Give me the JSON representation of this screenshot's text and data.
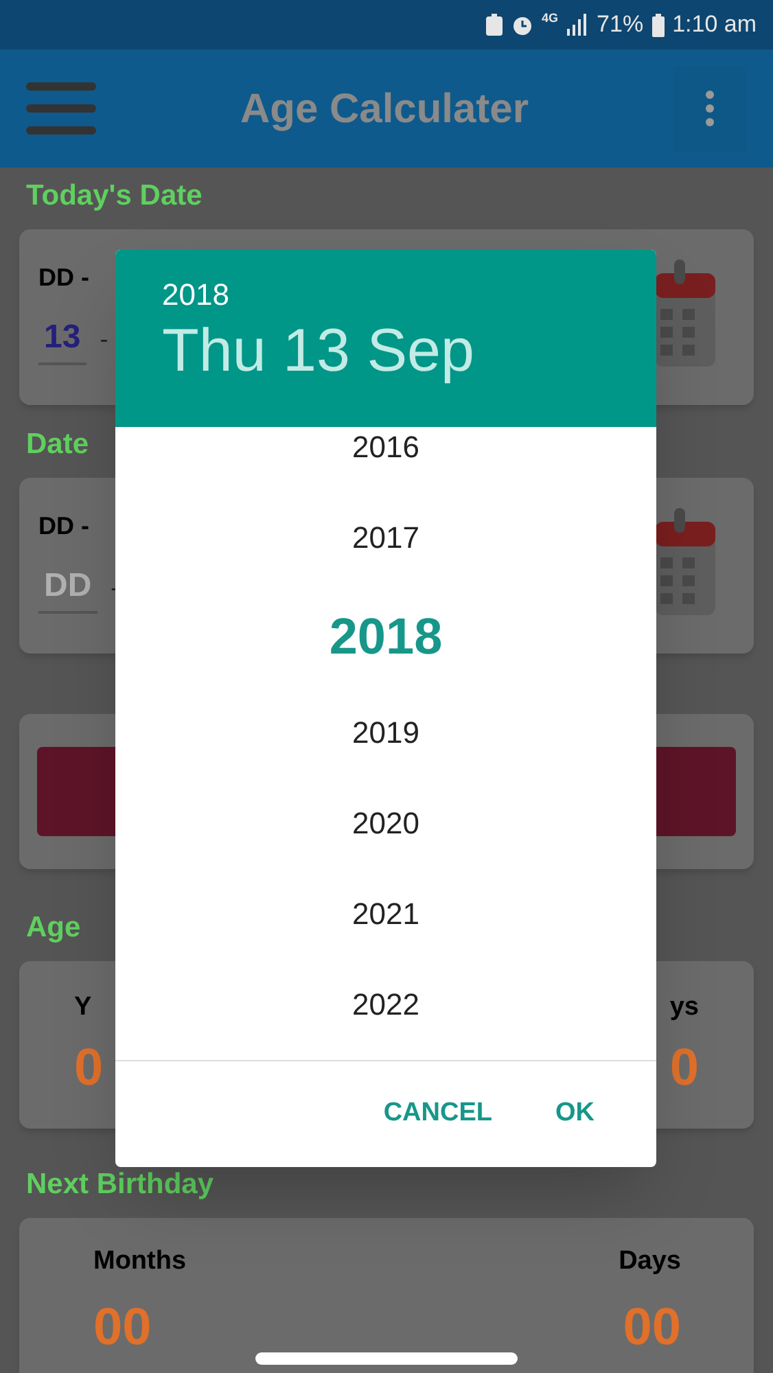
{
  "status_bar": {
    "network": "4G",
    "battery": "71%",
    "time": "1:10 am"
  },
  "app_bar": {
    "title": "Age Calculater"
  },
  "todays_date": {
    "heading": "Today's Date",
    "format_label": "DD -",
    "day_value": "13",
    "separator": "-"
  },
  "date_of_birth": {
    "heading": "Date",
    "format_label": "DD -",
    "day_placeholder": "DD",
    "separator": "-"
  },
  "age": {
    "heading": "Age",
    "left_label": "Y",
    "right_label": "ys",
    "left_value": "0",
    "right_value": "0"
  },
  "next_birthday": {
    "heading": "Next Birthday",
    "left_label": "Months",
    "right_label": "Days",
    "left_value": "00",
    "right_value": "00"
  },
  "dialog": {
    "header_year": "2018",
    "header_date": "Thu 13 Sep",
    "years": [
      {
        "label": "2016",
        "selected": false
      },
      {
        "label": "2017",
        "selected": false
      },
      {
        "label": "2018",
        "selected": true
      },
      {
        "label": "2019",
        "selected": false
      },
      {
        "label": "2020",
        "selected": false
      },
      {
        "label": "2021",
        "selected": false
      },
      {
        "label": "2022",
        "selected": false
      }
    ],
    "buttons": [
      "CANCEL",
      "OK"
    ]
  }
}
